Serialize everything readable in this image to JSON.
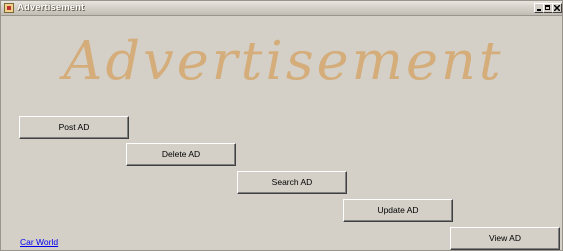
{
  "window": {
    "title": "Advertisement",
    "icon": "app-icon",
    "controls": [
      "minimize-icon",
      "maximize-icon",
      "close-icon"
    ]
  },
  "banner": {
    "text": "Advertisement",
    "color": "#d4ad7a"
  },
  "buttons": {
    "post_ad": "Post AD",
    "delete_ad": "Delete AD",
    "search_ad": "Search AD",
    "update_ad": "Update AD",
    "view_ad": "View AD"
  },
  "link": {
    "label": "Car World",
    "color": "#0000ee"
  }
}
